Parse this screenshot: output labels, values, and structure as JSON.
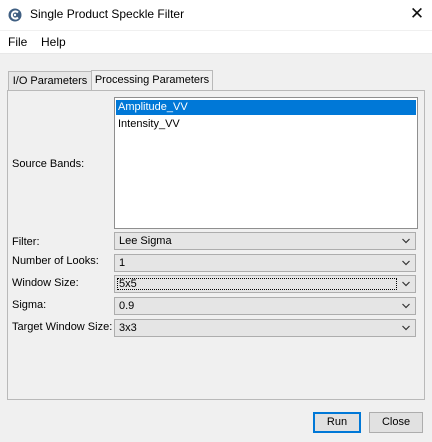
{
  "window": {
    "title": "Single Product Speckle Filter"
  },
  "menu": [
    "File",
    "Help"
  ],
  "tabs": [
    "I/O Parameters",
    "Processing Parameters"
  ],
  "form": {
    "source_bands_label": "Source Bands:",
    "source_bands": [
      {
        "name": "Amplitude_VV",
        "selected": true
      },
      {
        "name": "Intensity_VV",
        "selected": false
      }
    ],
    "filter_label": "Filter:",
    "filter_value": "Lee Sigma",
    "looks_label": "Number of Looks:",
    "looks_value": "1",
    "window_label": "Window Size:",
    "window_value": "5x5",
    "sigma_label": "Sigma:",
    "sigma_value": "0.9",
    "target_label": "Target Window Size:",
    "target_value": "3x3"
  },
  "buttons": {
    "run": "Run",
    "close": "Close"
  },
  "colors": {
    "selection": "#0078d7",
    "app_icon": "#3f5f82"
  }
}
